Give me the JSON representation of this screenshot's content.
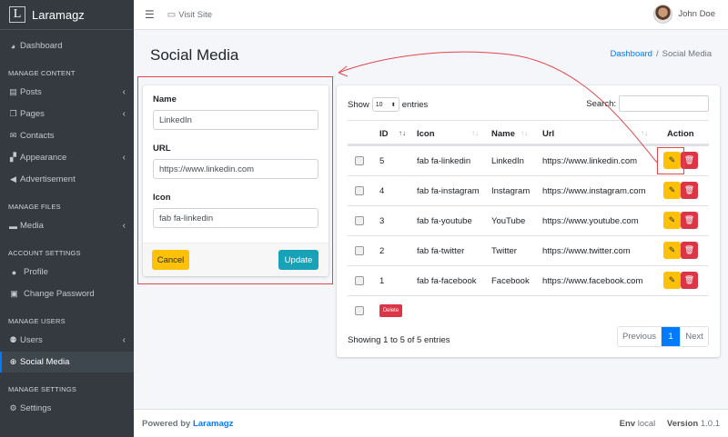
{
  "brand": {
    "logo_letter": "L",
    "name": "Laramagz"
  },
  "topbar": {
    "visit_label": "Visit Site",
    "user_name": "John Doe"
  },
  "sidebar": {
    "dashboard": "Dashboard",
    "header_content": "MANAGE CONTENT",
    "posts": "Posts",
    "pages": "Pages",
    "contacts": "Contacts",
    "appearance": "Appearance",
    "advertisement": "Advertisement",
    "header_files": "MANAGE FILES",
    "media": "Media",
    "header_account": "ACCOUNT SETTINGS",
    "profile": "Profile",
    "change_password": "Change Password",
    "header_users": "MANAGE USERS",
    "users": "Users",
    "social_media": "Social Media",
    "header_settings": "MANAGE SETTINGS",
    "settings": "Settings"
  },
  "page": {
    "title": "Social Media"
  },
  "breadcrumb": {
    "home": "Dashboard",
    "separator": "/",
    "current": "Social Media"
  },
  "form": {
    "name_label": "Name",
    "name_value": "LinkedIn",
    "url_label": "URL",
    "url_value": "https://www.linkedin.com",
    "icon_label": "Icon",
    "icon_value": "fab fa-linkedin",
    "cancel_label": "Cancel",
    "update_label": "Update"
  },
  "table": {
    "show_label": "Show",
    "length_value": "10",
    "entries_label": "entries",
    "search_label": "Search:",
    "columns": {
      "id": "ID",
      "icon": "Icon",
      "name": "Name",
      "url": "Url",
      "action": "Action"
    },
    "rows": [
      {
        "id": "5",
        "icon": "fab fa-linkedin",
        "name": "LinkedIn",
        "url": "https://www.linkedin.com"
      },
      {
        "id": "4",
        "icon": "fab fa-instagram",
        "name": "Instagram",
        "url": "https://www.instagram.com"
      },
      {
        "id": "3",
        "icon": "fab fa-youtube",
        "name": "YouTube",
        "url": "https://www.youtube.com"
      },
      {
        "id": "2",
        "icon": "fab fa-twitter",
        "name": "Twitter",
        "url": "https://www.twitter.com"
      },
      {
        "id": "1",
        "icon": "fab fa-facebook",
        "name": "Facebook",
        "url": "https://www.facebook.com"
      }
    ],
    "delete_label": "Delete",
    "info": "Showing 1 to 5 of 5 entries",
    "pagination": {
      "previous": "Previous",
      "current": "1",
      "next": "Next"
    }
  },
  "footer": {
    "powered_by": "Powered by",
    "brand": "Laramagz",
    "env_label": "Env",
    "env_value": "local",
    "version_label": "Version",
    "version_value": "1.0.1"
  },
  "colors": {
    "sidebar": "#343a40",
    "primary": "#007bff",
    "warning": "#ffc107",
    "danger": "#dc3545",
    "info": "#17a2b8",
    "annotation": "#e0484c"
  }
}
